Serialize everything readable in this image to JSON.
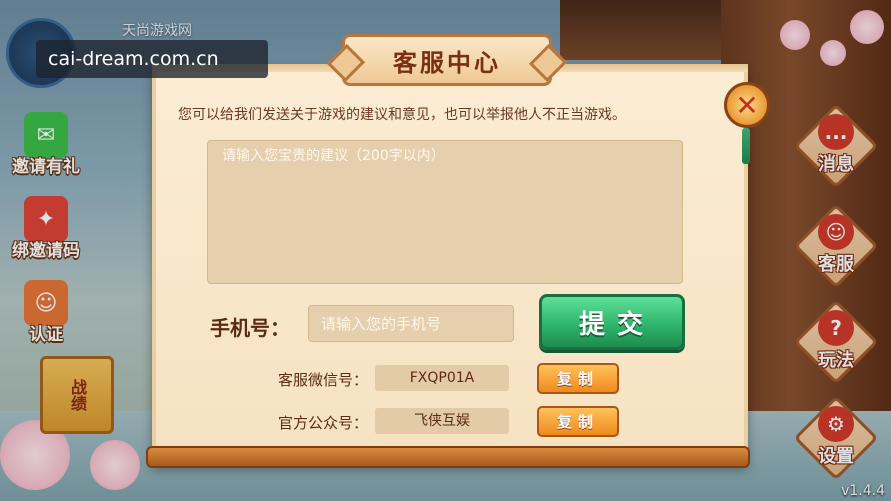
{
  "watermark": {
    "text": "cai-dream.com.cn"
  },
  "header": {
    "site_label": "天尚游戏网"
  },
  "left_menu": {
    "items": [
      {
        "label": "邀请有礼"
      },
      {
        "label": "绑邀请码"
      },
      {
        "label": "认证"
      }
    ],
    "box_label": "战绩"
  },
  "right_menu": {
    "items": [
      {
        "label": "消息",
        "icon": "..."
      },
      {
        "label": "客服",
        "icon": "☺"
      },
      {
        "label": "玩法",
        "icon": "?"
      },
      {
        "label": "设置",
        "icon": "⚙"
      }
    ]
  },
  "version": "v1.4.4",
  "dialog": {
    "title": "客服中心",
    "description": "您可以给我们发送关于游戏的建议和意见，也可以举报他人不正当游戏。",
    "suggestion_placeholder": "请输入您宝贵的建议（200字以内）",
    "phone_label": "手机号：",
    "phone_placeholder": "请输入您的手机号",
    "submit_label": "提交",
    "close_icon": "close-icon",
    "wechat_label": "客服微信号：",
    "wechat_value": "FXQP01A",
    "official_label": "官方公众号：",
    "official_value": "飞侠互娱",
    "copy_label": "复制"
  },
  "colors": {
    "accent_green": "#2fb56c",
    "accent_orange": "#ee8a1e",
    "paper": "#f6e2c2",
    "text_brown": "#5b2c12"
  }
}
